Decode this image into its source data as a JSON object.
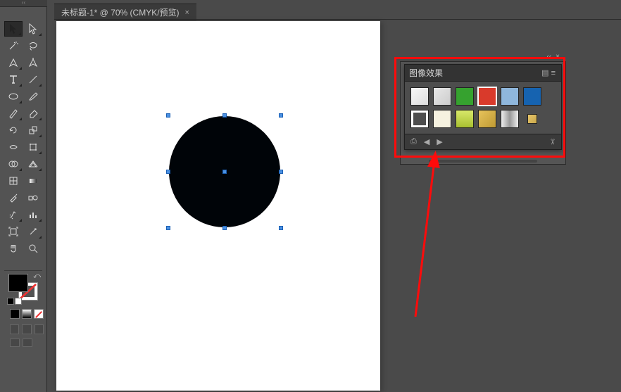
{
  "tab": {
    "title": "未标题-1* @ 70% (CMYK/预览)",
    "close": "×"
  },
  "toolbox": {
    "collapse": "‹‹",
    "tools": [
      {
        "name": "selection-tool",
        "selected": true
      },
      {
        "name": "direct-selection-tool"
      },
      {
        "name": "magic-wand-tool"
      },
      {
        "name": "lasso-tool"
      },
      {
        "name": "pen-tool"
      },
      {
        "name": "curvature-tool"
      },
      {
        "name": "type-tool"
      },
      {
        "name": "line-segment-tool"
      },
      {
        "name": "ellipse-tool"
      },
      {
        "name": "paintbrush-tool"
      },
      {
        "name": "pencil-tool"
      },
      {
        "name": "eraser-tool"
      },
      {
        "name": "rotate-tool"
      },
      {
        "name": "scale-tool"
      },
      {
        "name": "width-tool"
      },
      {
        "name": "free-transform-tool"
      },
      {
        "name": "shape-builder-tool"
      },
      {
        "name": "perspective-grid-tool"
      },
      {
        "name": "mesh-tool"
      },
      {
        "name": "gradient-tool"
      },
      {
        "name": "eyedropper-tool"
      },
      {
        "name": "blend-tool"
      },
      {
        "name": "symbol-sprayer-tool"
      },
      {
        "name": "column-graph-tool"
      },
      {
        "name": "artboard-tool"
      },
      {
        "name": "slice-tool"
      },
      {
        "name": "hand-tool"
      },
      {
        "name": "zoom-tool"
      }
    ]
  },
  "canvas": {
    "shape": "ellipse",
    "fill": "#000408"
  },
  "fx_panel": {
    "title": "图像效果",
    "menu": "▤ ≡",
    "collapse": "‹‹",
    "close": "×",
    "swatches": [
      {
        "name": "white-emboss",
        "bg": "linear-gradient(135deg,#f8f8f8,#ddd)"
      },
      {
        "name": "gray-smooth",
        "bg": "linear-gradient(135deg,#e8e8e8,#ccc)"
      },
      {
        "name": "green",
        "bg": "#36a22f"
      },
      {
        "name": "red",
        "bg": "#d93a2b",
        "selected": true
      },
      {
        "name": "light-blue",
        "bg": "#8fb7dc"
      },
      {
        "name": "blue",
        "bg": "#1663b0"
      },
      {
        "name": "outline",
        "bg": "#fff"
      },
      {
        "name": "cream",
        "bg": "#f6f2e0"
      },
      {
        "name": "lime-grad",
        "bg": "linear-gradient(#d8e86a,#a8c030)"
      },
      {
        "name": "gold-grad",
        "bg": "linear-gradient(135deg,#e7c35b,#bf9a33)"
      },
      {
        "name": "silver-grad",
        "bg": "linear-gradient(90deg,#eee,#999,#eee)"
      },
      {
        "name": "small-cube",
        "bg": "linear-gradient(135deg,#e7c56a,#caa84a)"
      }
    ],
    "footer": {
      "lib": "⎙",
      "prev": "◀",
      "next": "▶",
      "trash": "✂"
    }
  }
}
